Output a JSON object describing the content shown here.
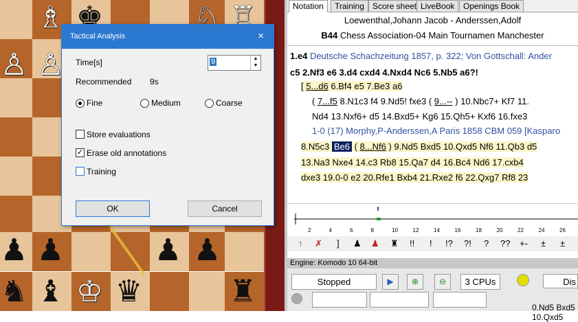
{
  "dialog": {
    "title": "Tactical Analysis",
    "close_glyph": "×",
    "time_label": "Time[s]",
    "time_value": "9",
    "recommended_label": "Recommended",
    "recommended_value": "9s",
    "mode_options": [
      "Fine",
      "Medium",
      "Coarse"
    ],
    "mode_selected": "Fine",
    "checkboxes": [
      {
        "label": "Store evaluations",
        "checked": false
      },
      {
        "label": "Erase old annotations",
        "checked": true
      },
      {
        "label": "Training",
        "checked": false
      }
    ],
    "ok_label": "OK",
    "cancel_label": "Cancel"
  },
  "tabs": [
    "Notation",
    "Training",
    "Score sheet",
    "LiveBook",
    "Openings Book"
  ],
  "active_tab": "Notation",
  "notation": {
    "players": "Loewenthal,Johann Jacob - Anderssen,Adolf",
    "event_eco": "B44",
    "event": "Chess Association-04 Main Tournamen Manchester",
    "line1_move": "1.e4",
    "line1_comment": "Deutsche Schachzeitung 1857, p. 322; Von Gottschall: Ander",
    "line2": "c5  2.Nf3  e6  3.d4  cxd4  4.Nxd4  Nc6  5.Nb5  a6?!",
    "line3_a": "[ ",
    "line3_b": "5...d6",
    "line3_c": "  6.Bf4  e5  7.Be3  a6",
    "line4_a": "( ",
    "line4_b": "7...f5",
    "line4_c": "  8.N1c3  f4  9.Nd5!  fxe3  ( ",
    "line4_d": "9...--",
    "line4_e": " )  10.Nbc7+  Kf7  11.",
    "line5": "Nd4  13.Nxf6+  d5  14.Bxd5+  Kg6  15.Qh5+  Kxf6  16.fxe3",
    "line6": "1-0 (17) Morphy,P-Anderssen,A Paris 1858 CBM 059 [Kasparo",
    "line7_a": "8.N5c3",
    "line7_current": "Be6",
    "line7_b": "( ",
    "line7_c": "8...Nf6",
    "line7_d": " )  9.Nd5  Bxd5  10.Qxd5  Nf6  11.Qb3  d5",
    "line8": "13.Na3  Nxe4  14.c3  Rb8  15.Qa7  d4  16.Bc4  Nd6  17.cxb4",
    "line9": "dxe3  19.0-0  e2  20.Rfe1  Bxb4  21.Rxe2  f6  22.Qxg7  Rf8  23"
  },
  "graph_ticks": [
    "2",
    "4",
    "6",
    "8",
    "10",
    "12",
    "14",
    "16",
    "18",
    "20",
    "22",
    "24",
    "26"
  ],
  "symbols": [
    "!!",
    "!",
    "!?",
    "?!",
    "?",
    "??",
    "+-",
    "±",
    "±"
  ],
  "engine": {
    "title": "Engine: Komodo 10 64-bit",
    "status": "Stopped",
    "cpus": "3 CPUs",
    "dis_label": "Dis",
    "line": "0.Nd5  Bxd5  10.Qxd5"
  },
  "colors": {
    "accent": "#2b78d0",
    "light_square": "#e8c49a",
    "dark_square": "#b5652a"
  }
}
